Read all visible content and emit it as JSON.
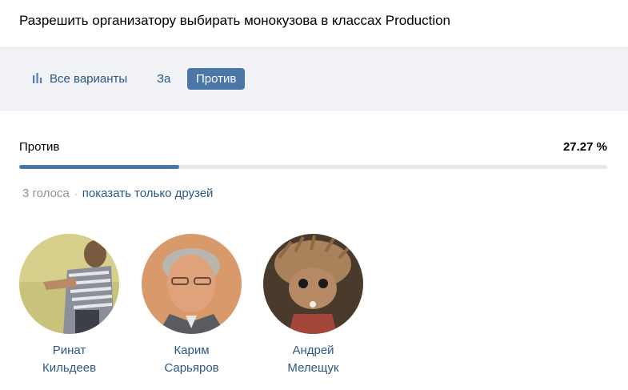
{
  "poll": {
    "title": "Разрешить организатору выбирать монокузова в классах Production"
  },
  "tabs": {
    "all": {
      "label": "Все варианты",
      "icon": "bar-chart-icon"
    },
    "for": {
      "label": "За"
    },
    "against": {
      "label": "Против",
      "active": true
    }
  },
  "result": {
    "label": "Против",
    "percent_text": "27.27 %",
    "fraction": 0.2727
  },
  "votes": {
    "count_text": "3 голоса",
    "separator": "·",
    "friends_link": "показать только друзей"
  },
  "voters": [
    {
      "first_name": "Ринат",
      "last_name": "Кильдеев"
    },
    {
      "first_name": "Карим",
      "last_name": "Сарьяров"
    },
    {
      "first_name": "Андрей",
      "last_name": "Мелещук"
    }
  ],
  "colors": {
    "accent": "#4a76a8",
    "link": "#2a5885",
    "tabs_background": "#f0f2f5",
    "muted_text": "#939393"
  }
}
